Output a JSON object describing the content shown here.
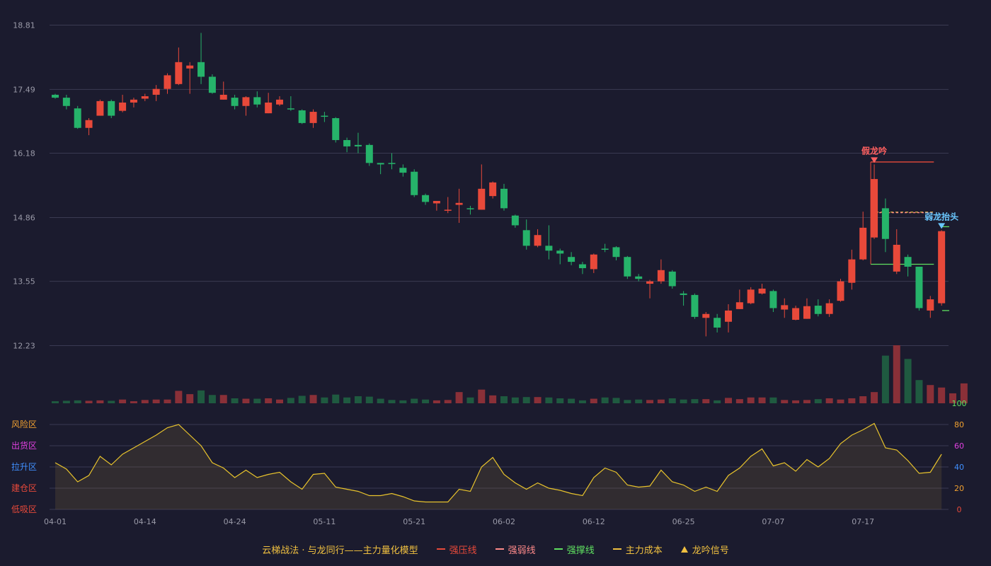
{
  "colors": {
    "background": "#1b1b2e",
    "up": "#e8493a",
    "down": "#26b36a",
    "grid": "#3a3a52",
    "axis_text": "#9a9aa8",
    "osc_line": "#e8c32c",
    "strong_press": "#e8493a",
    "strong_weak": "#ff8a8a",
    "strong_support": "#5fe060",
    "main_cost": "#f0c040",
    "volume_up": "#8a3038",
    "volume_down": "#1f5a40",
    "annotation_red": "#ff6060",
    "annotation_blue": "#6ac8ff"
  },
  "chart_data": {
    "type": "candlestick",
    "price_axis": {
      "ticks": [
        "18.81",
        "17.49",
        "16.18",
        "14.86",
        "13.55",
        "12.23"
      ],
      "range": [
        12.23,
        18.81
      ]
    },
    "x_ticks": [
      {
        "label": "04-01",
        "index": 0
      },
      {
        "label": "04-14",
        "index": 8
      },
      {
        "label": "04-24",
        "index": 16
      },
      {
        "label": "05-11",
        "index": 24
      },
      {
        "label": "05-21",
        "index": 32
      },
      {
        "label": "06-02",
        "index": 40
      },
      {
        "label": "06-12",
        "index": 48
      },
      {
        "label": "06-25",
        "index": 56
      },
      {
        "label": "07-07",
        "index": 64
      },
      {
        "label": "07-17",
        "index": 72
      }
    ],
    "candles": [
      [
        17.38,
        17.32,
        17.4,
        17.3
      ],
      [
        17.32,
        17.15,
        17.38,
        17.08
      ],
      [
        17.1,
        16.7,
        17.15,
        16.68
      ],
      [
        16.7,
        16.86,
        16.9,
        16.55
      ],
      [
        16.95,
        17.25,
        17.28,
        16.95
      ],
      [
        17.25,
        16.95,
        17.28,
        16.9
      ],
      [
        17.05,
        17.22,
        17.38,
        17.02
      ],
      [
        17.22,
        17.28,
        17.32,
        17.12
      ],
      [
        17.3,
        17.35,
        17.4,
        17.25
      ],
      [
        17.38,
        17.5,
        17.58,
        17.25
      ],
      [
        17.5,
        17.78,
        17.82,
        17.4
      ],
      [
        17.6,
        18.05,
        18.35,
        17.58
      ],
      [
        17.92,
        17.98,
        18.05,
        17.4
      ],
      [
        18.05,
        17.75,
        18.65,
        17.6
      ],
      [
        17.75,
        17.42,
        17.8,
        17.4
      ],
      [
        17.28,
        17.38,
        17.65,
        17.28
      ],
      [
        17.32,
        17.15,
        17.38,
        17.08
      ],
      [
        17.15,
        17.33,
        17.35,
        16.95
      ],
      [
        17.33,
        17.18,
        17.45,
        17.12
      ],
      [
        17.0,
        17.22,
        17.42,
        17.0
      ],
      [
        17.18,
        17.28,
        17.35,
        17.15
      ],
      [
        17.1,
        17.08,
        17.35,
        17.05
      ],
      [
        17.06,
        16.8,
        17.08,
        16.78
      ],
      [
        16.8,
        17.03,
        17.08,
        16.7
      ],
      [
        16.95,
        16.94,
        17.03,
        16.82
      ],
      [
        16.9,
        16.45,
        16.92,
        16.4
      ],
      [
        16.45,
        16.32,
        16.5,
        16.2
      ],
      [
        16.35,
        16.32,
        16.6,
        16.18
      ],
      [
        16.35,
        15.98,
        16.38,
        15.92
      ],
      [
        15.98,
        15.95,
        15.98,
        15.75
      ],
      [
        15.98,
        15.96,
        16.18,
        15.85
      ],
      [
        15.88,
        15.78,
        15.95,
        15.7
      ],
      [
        15.8,
        15.32,
        15.85,
        15.28
      ],
      [
        15.32,
        15.18,
        15.35,
        15.12
      ],
      [
        15.15,
        15.2,
        15.2,
        15.0
      ],
      [
        15.02,
        15.02,
        15.28,
        14.95
      ],
      [
        15.12,
        15.16,
        15.45,
        14.75
      ],
      [
        15.05,
        15.04,
        15.1,
        14.92
      ],
      [
        15.02,
        15.45,
        15.95,
        15.02
      ],
      [
        15.3,
        15.58,
        15.6,
        15.25
      ],
      [
        15.45,
        15.05,
        15.55,
        15.0
      ],
      [
        14.9,
        14.7,
        14.92,
        14.65
      ],
      [
        14.6,
        14.28,
        14.82,
        14.2
      ],
      [
        14.28,
        14.5,
        14.62,
        14.25
      ],
      [
        14.28,
        14.18,
        14.7,
        14.0
      ],
      [
        14.18,
        14.12,
        14.22,
        13.9
      ],
      [
        14.05,
        13.95,
        14.15,
        13.88
      ],
      [
        13.9,
        13.82,
        13.95,
        13.7
      ],
      [
        13.8,
        14.1,
        14.12,
        13.72
      ],
      [
        14.22,
        14.2,
        14.32,
        14.15
      ],
      [
        14.25,
        14.05,
        14.27,
        13.98
      ],
      [
        14.05,
        13.65,
        14.07,
        13.6
      ],
      [
        13.65,
        13.6,
        13.7,
        13.55
      ],
      [
        13.5,
        13.55,
        13.58,
        13.2
      ],
      [
        13.55,
        13.78,
        14.0,
        13.5
      ],
      [
        13.75,
        13.45,
        13.78,
        13.4
      ],
      [
        13.3,
        13.27,
        13.35,
        13.05
      ],
      [
        13.27,
        12.82,
        13.3,
        12.78
      ],
      [
        12.8,
        12.88,
        12.92,
        12.42
      ],
      [
        12.8,
        12.6,
        12.88,
        12.5
      ],
      [
        12.72,
        12.95,
        13.08,
        12.5
      ],
      [
        12.98,
        13.12,
        13.38,
        12.98
      ],
      [
        13.1,
        13.38,
        13.43,
        13.08
      ],
      [
        13.3,
        13.4,
        13.5,
        13.28
      ],
      [
        13.35,
        13.0,
        13.38,
        12.92
      ],
      [
        12.97,
        13.06,
        13.2,
        12.8
      ],
      [
        12.76,
        13.0,
        13.05,
        12.75
      ],
      [
        12.78,
        13.04,
        13.2,
        12.78
      ],
      [
        13.05,
        12.88,
        13.18,
        12.83
      ],
      [
        12.88,
        13.1,
        13.18,
        12.82
      ],
      [
        13.15,
        13.55,
        13.6,
        13.13
      ],
      [
        13.52,
        14.0,
        14.2,
        13.38
      ],
      [
        14.0,
        14.65,
        14.98,
        13.98
      ],
      [
        14.45,
        15.65,
        15.95,
        14.42
      ],
      [
        15.05,
        14.42,
        15.25,
        14.15
      ],
      [
        13.75,
        14.3,
        14.62,
        13.7
      ],
      [
        14.05,
        13.85,
        14.1,
        13.65
      ],
      [
        13.85,
        13.0,
        13.85,
        12.95
      ],
      [
        12.95,
        13.18,
        13.25,
        12.8
      ],
      [
        13.1,
        14.58,
        14.6,
        13.05
      ]
    ],
    "lines": {
      "strong_press": {
        "x": [
          73,
          78
        ],
        "y": 16.0
      },
      "strong_weak": {
        "x": [
          73,
          78
        ],
        "y": 14.96
      },
      "strong_support": {
        "x": [
          73,
          78
        ],
        "y": 13.9
      },
      "main_cost": {
        "x": [
          73,
          78
        ],
        "y": 14.97
      }
    },
    "annotations": [
      {
        "text": "假龙吟",
        "index": 73,
        "price": 15.95,
        "color": "red"
      },
      {
        "text": "弱龙抬头",
        "index": 79,
        "price": 14.6,
        "color": "blue"
      }
    ],
    "volume": [
      5,
      6,
      7,
      6,
      7,
      6,
      9,
      5,
      8,
      9,
      9,
      30,
      22,
      31,
      20,
      20,
      12,
      11,
      11,
      12,
      9,
      13,
      18,
      20,
      14,
      21,
      14,
      17,
      16,
      11,
      8,
      7,
      11,
      9,
      7,
      8,
      27,
      14,
      33,
      19,
      17,
      14,
      15,
      15,
      14,
      12,
      11,
      7,
      11,
      14,
      13,
      8,
      9,
      8,
      9,
      12,
      9,
      10,
      10,
      7,
      13,
      10,
      14,
      14,
      14,
      8,
      7,
      8,
      10,
      12,
      9,
      12,
      17,
      27,
      115,
      140,
      107,
      56,
      44,
      38,
      24,
      48
    ],
    "oscillator": {
      "y_ticks_right": [
        "100",
        "80",
        "60",
        "40",
        "20",
        "0"
      ],
      "zones_left": [
        "风险区",
        "出货区",
        "拉升区",
        "建仓区",
        "低吸区"
      ],
      "values": [
        44,
        38,
        26,
        32,
        50,
        42,
        52,
        58,
        64,
        70,
        77,
        80,
        70,
        60,
        44,
        39,
        30,
        37,
        30,
        33,
        35,
        26,
        19,
        33,
        34,
        21,
        19,
        17,
        13,
        13,
        15,
        12,
        8,
        7,
        7,
        7,
        19,
        17,
        40,
        49,
        33,
        25,
        19,
        25,
        20,
        18,
        15,
        13,
        30,
        39,
        35,
        23,
        21,
        22,
        37,
        26,
        23,
        17,
        21,
        17,
        32,
        39,
        50,
        57,
        41,
        44,
        36,
        47,
        40,
        48,
        62,
        70,
        75,
        81,
        58,
        56,
        46,
        34,
        35,
        52
      ]
    }
  },
  "legend": {
    "title": "云梯战法 · 与龙同行——主力量化模型",
    "items": [
      {
        "label": "强压线",
        "color": "#e8493a",
        "style": "solid"
      },
      {
        "label": "强弱线",
        "color": "#ff8a8a",
        "style": "dashed"
      },
      {
        "label": "强撑线",
        "color": "#5fe060",
        "style": "solid"
      },
      {
        "label": "主力成本",
        "color": "#f0c040",
        "style": "dashed"
      },
      {
        "label": "龙吟信号",
        "color": "#f0c040",
        "style": "triangle"
      }
    ]
  }
}
